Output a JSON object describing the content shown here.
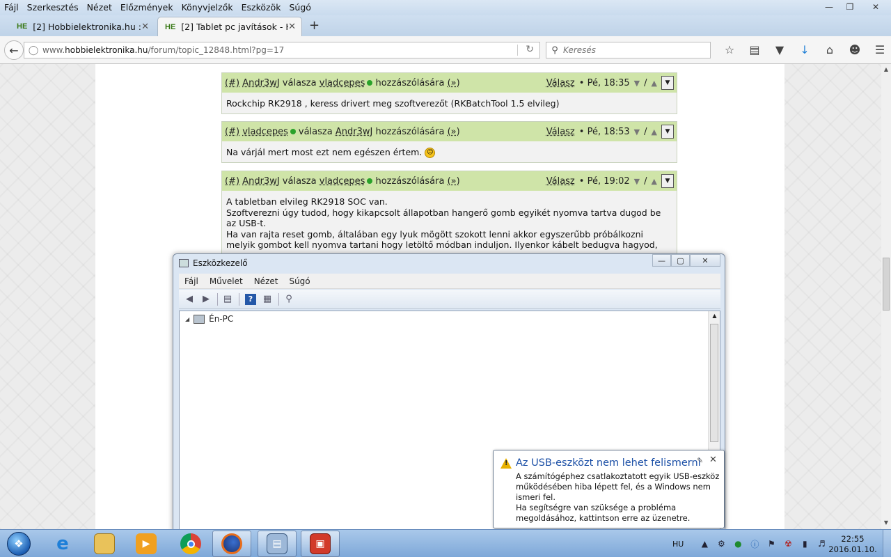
{
  "browser": {
    "menu": [
      "Fájl",
      "Szerkesztés",
      "Nézet",
      "Előzmények",
      "Könyvjelzők",
      "Eszközök",
      "Súgó"
    ],
    "tabs": [
      {
        "favicon": "HE",
        "title": "[2] Hobbielektronika.hu ::"
      },
      {
        "favicon": "HE",
        "title": "[2] Tablet pc javítások - Ho..."
      }
    ],
    "url_prefix": "www.",
    "url_domain": "hobbielektronika.hu",
    "url_path": "/forum/topic_12848.html?pg=17",
    "search_placeholder": "Keresés"
  },
  "posts": [
    {
      "num": "(#)",
      "author": "Andr3wJ",
      "reply_word": "válasza",
      "target": "vladcepes",
      "suffix": "hozzászólására",
      "link": "(»)",
      "reply_label": "Válasz",
      "time": "• Pé, 18:35",
      "body": [
        "Rockchip RK2918 , keress drivert meg szoftverezőt (RKBatchTool 1.5 elvileg)"
      ]
    },
    {
      "num": "(#)",
      "author": "vladcepes",
      "reply_word": "válasza",
      "target": "Andr3wJ",
      "suffix": "hozzászólására",
      "link": "(»)",
      "reply_label": "Válasz",
      "time": "• Pé, 18:53",
      "body": [
        "Na várjál mert most ezt nem egészen értem."
      ]
    },
    {
      "num": "(#)",
      "author": "Andr3wJ",
      "reply_word": "válasza",
      "target": "vladcepes",
      "suffix": "hozzászólására",
      "link": "(»)",
      "reply_label": "Válasz",
      "time": "• Pé, 19:02",
      "body": [
        "A tabletban elvileg RK2918 SOC van.",
        "Szoftverezni úgy tudod, hogy kikapcsolt állapotban hangerő gomb egyikét nyomva tartva dugod be az USB-t.",
        "Ha van rajta reset gomb, általában egy lyuk mögött szokott lenni akkor egyszerűbb próbálkozni melyik gombot kell nyomva tartani hogy letöltő módban induljon. Ilyenkor kábelt bedugva hagyod,"
      ]
    }
  ],
  "device_manager": {
    "title": "Eszközkezelő",
    "menu": [
      "Fájl",
      "Művelet",
      "Nézet",
      "Súgó"
    ],
    "tree_root": "Én-PC"
  },
  "notification": {
    "title": "Az USB-eszközt nem lehet felismerni",
    "body": [
      "A számítógéphez csatlakoztatott egyik USB-eszköz működésében hiba lépett fel, és a Windows nem ismeri fel.",
      "Ha segítségre van szüksége a probléma megoldásához, kattintson erre az üzenetre."
    ]
  },
  "taskbar": {
    "language": "HU",
    "time": "22:55",
    "date": "2016.01.10."
  }
}
